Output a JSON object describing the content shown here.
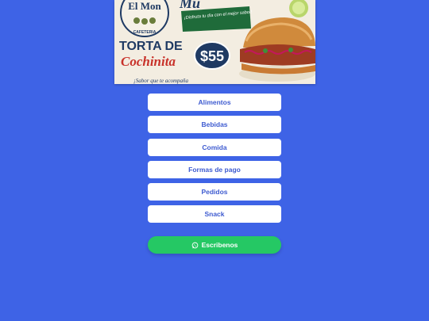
{
  "banner": {
    "brand_top": "El Mon",
    "brand_sub": "CAFETERIA",
    "headline_partial": "Mu",
    "tagline": "¡Disfruta tu día con el mejor sabor!",
    "product_line1": "TORTA DE",
    "product_line2": "Cochinita",
    "price": "$55",
    "slogan": "¡Sabor que te acompaña"
  },
  "menu": {
    "items": [
      {
        "label": "Alimentos"
      },
      {
        "label": "Bebidas"
      },
      {
        "label": "Comida"
      },
      {
        "label": "Formas de pago"
      },
      {
        "label": "Pedidos"
      },
      {
        "label": "Snack"
      }
    ]
  },
  "whatsapp": {
    "label": "Escribenos",
    "icon": "whatsapp-icon",
    "color": "#25c864"
  },
  "colors": {
    "background": "#3e63e6",
    "button_text": "#3e5bd0"
  }
}
